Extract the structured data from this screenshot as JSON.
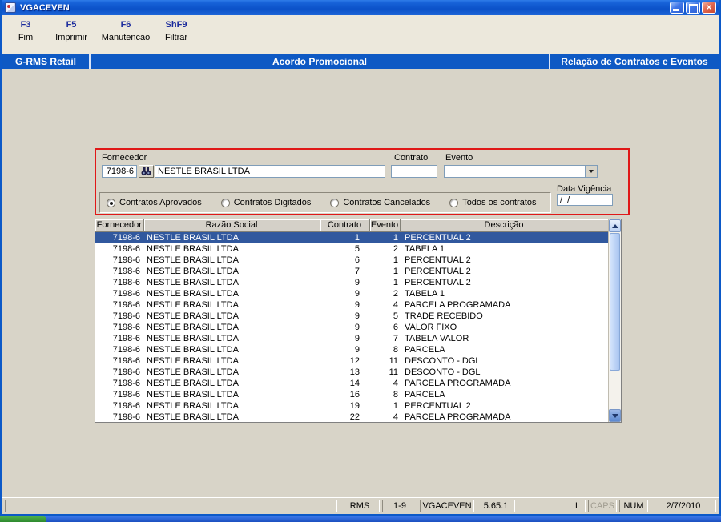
{
  "window": {
    "title": "VGACEVEN"
  },
  "toolbar": {
    "items": [
      {
        "key": "F3",
        "label": "Fim"
      },
      {
        "key": "F5",
        "label": "Imprimir"
      },
      {
        "key": "F6",
        "label": "Manutencao"
      },
      {
        "key": "ShF9",
        "label": "Filtrar"
      }
    ]
  },
  "header": {
    "left": "G-RMS Retail",
    "center": "Acordo Promocional",
    "right": "Relação de Contratos e Eventos"
  },
  "filter": {
    "fornecedor_label": "Fornecedor",
    "fornecedor_code": "7198-6",
    "fornecedor_name": "NESTLE BRASIL LTDA",
    "contrato_label": "Contrato",
    "contrato_value": "",
    "evento_label": "Evento",
    "evento_value": "",
    "data_vigencia_label": "Data Vigência",
    "data_vigencia_value": "/  /",
    "radios": [
      {
        "label": "Contratos Aprovados",
        "checked": true
      },
      {
        "label": "Contratos Digitados",
        "checked": false
      },
      {
        "label": "Contratos Cancelados",
        "checked": false
      },
      {
        "label": "Todos os contratos",
        "checked": false
      }
    ]
  },
  "grid": {
    "columns": [
      "Fornecedor",
      "Razão Social",
      "Contrato",
      "Evento",
      "Descrição"
    ],
    "selected_row": 0,
    "rows": [
      [
        "7198-6",
        "NESTLE BRASIL LTDA",
        "1",
        "1",
        "PERCENTUAL 2"
      ],
      [
        "7198-6",
        "NESTLE BRASIL LTDA",
        "5",
        "2",
        "TABELA 1"
      ],
      [
        "7198-6",
        "NESTLE BRASIL LTDA",
        "6",
        "1",
        "PERCENTUAL 2"
      ],
      [
        "7198-6",
        "NESTLE BRASIL LTDA",
        "7",
        "1",
        "PERCENTUAL 2"
      ],
      [
        "7198-6",
        "NESTLE BRASIL LTDA",
        "9",
        "1",
        "PERCENTUAL 2"
      ],
      [
        "7198-6",
        "NESTLE BRASIL LTDA",
        "9",
        "2",
        "TABELA 1"
      ],
      [
        "7198-6",
        "NESTLE BRASIL LTDA",
        "9",
        "4",
        "PARCELA PROGRAMADA"
      ],
      [
        "7198-6",
        "NESTLE BRASIL LTDA",
        "9",
        "5",
        "TRADE RECEBIDO"
      ],
      [
        "7198-6",
        "NESTLE BRASIL LTDA",
        "9",
        "6",
        "VALOR FIXO"
      ],
      [
        "7198-6",
        "NESTLE BRASIL LTDA",
        "9",
        "7",
        "TABELA VALOR"
      ],
      [
        "7198-6",
        "NESTLE BRASIL LTDA",
        "9",
        "8",
        "PARCELA"
      ],
      [
        "7198-6",
        "NESTLE BRASIL LTDA",
        "12",
        "11",
        "DESCONTO - DGL"
      ],
      [
        "7198-6",
        "NESTLE BRASIL LTDA",
        "13",
        "11",
        "DESCONTO - DGL"
      ],
      [
        "7198-6",
        "NESTLE BRASIL LTDA",
        "14",
        "4",
        "PARCELA PROGRAMADA"
      ],
      [
        "7198-6",
        "NESTLE BRASIL LTDA",
        "16",
        "8",
        "PARCELA"
      ],
      [
        "7198-6",
        "NESTLE BRASIL LTDA",
        "19",
        "1",
        "PERCENTUAL 2"
      ],
      [
        "7198-6",
        "NESTLE BRASIL LTDA",
        "22",
        "4",
        "PARCELA PROGRAMADA"
      ]
    ]
  },
  "statusbar": {
    "system": "RMS",
    "record_range": "1-9",
    "program": "VGACEVEN",
    "version": "5.65.1",
    "l_indicator": "L",
    "caps_indicator": "CAPS",
    "num_indicator": "NUM",
    "date": "2/7/2010"
  },
  "colors": {
    "titlebar_blue": "#0C59C8",
    "header_blue": "#0E59C4",
    "selection_blue": "#31589E",
    "outline_red": "#E01818"
  }
}
